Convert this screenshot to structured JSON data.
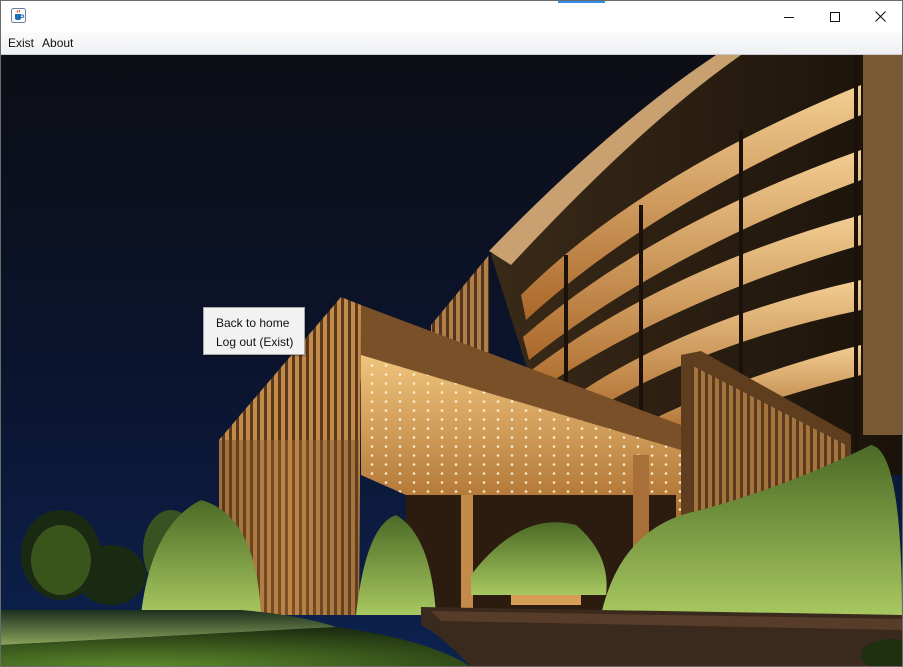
{
  "window": {
    "title": "",
    "app_icon": "java-coffee-cup-icon",
    "controls": [
      "minimize-icon",
      "maximize-icon",
      "close-icon"
    ],
    "accent_color": "#2d8ef0"
  },
  "menubar": {
    "items": [
      {
        "label": "Exist"
      },
      {
        "label": "About"
      }
    ]
  },
  "popup_menu": {
    "items": [
      {
        "label": "Back to home"
      },
      {
        "label": "Log out (Exist)"
      }
    ]
  },
  "content": {
    "image": "night-view-of-modern-hotel-entrance-with-illuminated-canopy",
    "colors": {
      "sky": "#0b1430",
      "canopy_light": "#e8b66a",
      "foliage": "#7ea34a"
    }
  }
}
